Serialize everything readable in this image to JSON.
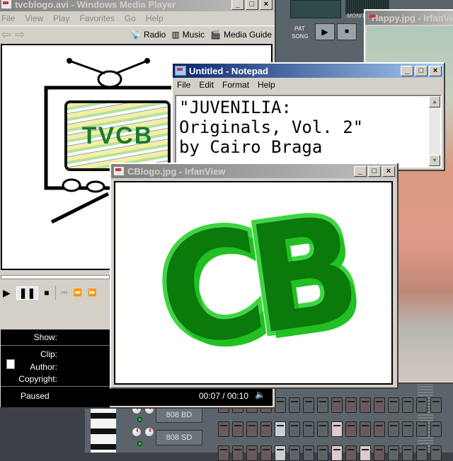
{
  "fl_studio": {
    "pat_label": "PAT",
    "song_label": "SONG",
    "monitor_label": "MONITOR",
    "channels": [
      {
        "name": "808 BD"
      },
      {
        "name": "808 SD"
      }
    ]
  },
  "wmp": {
    "title": "tvcblogo.avi - Windows Media Player",
    "menu": [
      "File",
      "View",
      "Play",
      "Favorites",
      "Go",
      "Help"
    ],
    "nav": {
      "radio": "Radio",
      "music": "Music",
      "media_guide": "Media Guide"
    },
    "video_text": "TVCB",
    "info": {
      "show": "Show:",
      "clip": "Clip:",
      "author": "Author:",
      "copyright": "Copyright:"
    },
    "status": "Paused",
    "time": "00:07 / 00:10"
  },
  "happy": {
    "title": "Happy.jpg - IrfanView"
  },
  "notepad": {
    "title": "Untitled - Notepad",
    "menu": [
      "File",
      "Edit",
      "Format",
      "Help"
    ],
    "lines": [
      "\"JUVENILIA:",
      "Originals, Vol. 2\"",
      "by Cairo Braga"
    ]
  },
  "cblogo": {
    "title": "CBlogo.jpg - IrfanView",
    "logo_text": "CB"
  },
  "title_buttons": {
    "minimize": "_",
    "maximize": "□",
    "close": "×"
  }
}
